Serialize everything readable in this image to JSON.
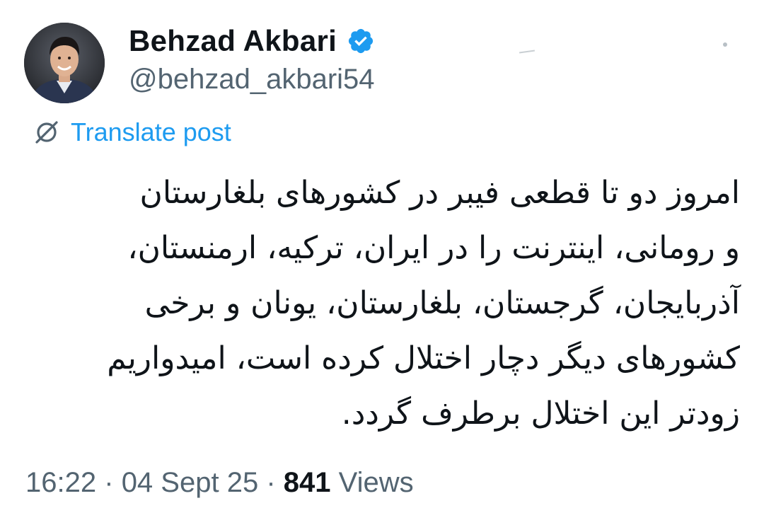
{
  "author": {
    "display_name": "Behzad Akbari",
    "handle": "@behzad_akbari54",
    "verified": true
  },
  "translate": {
    "label": "Translate post"
  },
  "post": {
    "lines": [
      "امروز دو تا قطعی فیبر در کشورهای بلغارستان",
      "و رومانی، اینترنت را در ایران، ترکیه، ارمنستان،",
      "آذربایجان، گرجستان، بلغارستان، یونان و برخی",
      "کشورهای دیگر دچار اختلال کرده است، امیدواریم",
      "زودتر این اختلال برطرف گردد."
    ]
  },
  "meta": {
    "time": "16:22",
    "separator": "·",
    "date": "04 Sept 25",
    "views_count": "841",
    "views_label": "Views"
  },
  "colors": {
    "accent": "#1d9bf0",
    "secondary_text": "#536471",
    "primary_text": "#0f1419"
  },
  "icons": {
    "verified": "verified-badge-icon",
    "translate": "globe-slash-icon",
    "more": "more-dot-icon"
  }
}
